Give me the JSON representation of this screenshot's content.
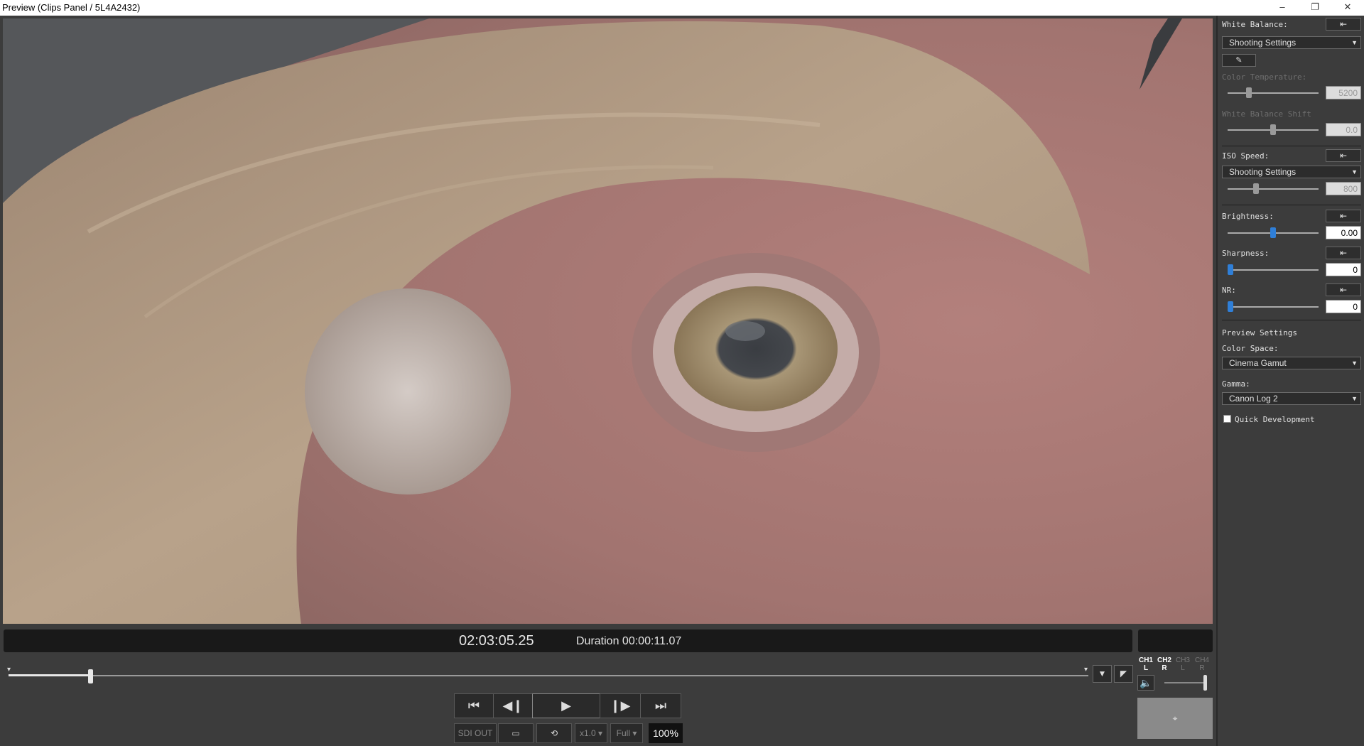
{
  "window": {
    "title": "Preview (Clips Panel / 5L4A2432)",
    "minimize_icon": "minimize-icon",
    "restore_icon": "restore-icon",
    "close_icon": "close-icon"
  },
  "playback": {
    "timecode": "02:03:05.25",
    "duration": "Duration 00:00:11.07",
    "position_fraction": 0.074
  },
  "audio": {
    "channels": [
      {
        "top": "CH1",
        "bottom": "L",
        "active": true
      },
      {
        "top": "CH2",
        "bottom": "R",
        "active": true
      },
      {
        "top": "CH3",
        "bottom": "L",
        "active": false
      },
      {
        "top": "CH4",
        "bottom": "R",
        "active": false
      }
    ],
    "volume_fraction": 0.95
  },
  "transport": {
    "sdi_out": "SDI OUT",
    "speed": "x1.0",
    "quality": "Full",
    "zoom": "100%"
  },
  "panel": {
    "white_balance": {
      "label": "White Balance:",
      "mode": "Shooting Settings"
    },
    "color_temperature": {
      "label": "Color Temperature:",
      "value": "5200",
      "fraction": 0.22
    },
    "white_balance_shift": {
      "label": "White Balance Shift",
      "value": "0.0",
      "fraction": 0.5
    },
    "iso_speed": {
      "label": "ISO Speed:",
      "mode": "Shooting Settings",
      "value": "800",
      "fraction": 0.3
    },
    "brightness": {
      "label": "Brightness:",
      "value": "0.00",
      "fraction": 0.5
    },
    "sharpness": {
      "label": "Sharpness:",
      "value": "0",
      "fraction": 0.0
    },
    "nr": {
      "label": "NR:",
      "value": "0",
      "fraction": 0.0
    },
    "preview_settings": {
      "label": "Preview Settings"
    },
    "color_space": {
      "label": "Color Space:",
      "value": "Cinema Gamut"
    },
    "gamma": {
      "label": "Gamma:",
      "value": "Canon Log 2"
    },
    "quick_development": {
      "label": "Quick Development",
      "checked": false
    }
  }
}
